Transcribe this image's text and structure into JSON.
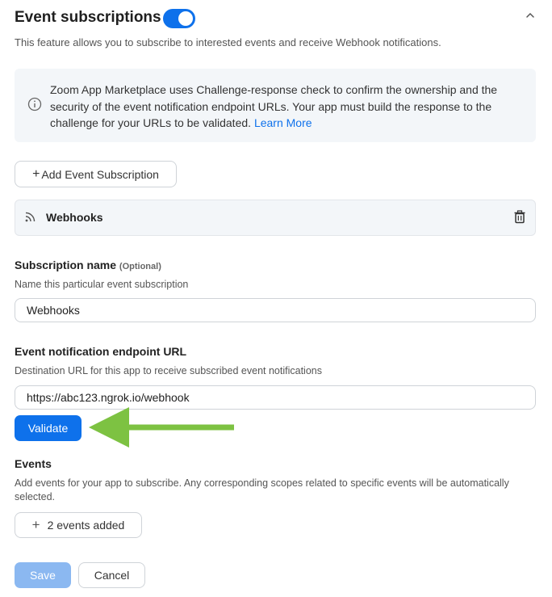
{
  "header": {
    "title": "Event subscriptions",
    "toggle_on": true,
    "description": "This feature allows you to subscribe to interested events and receive Webhook notifications."
  },
  "info": {
    "text": "Zoom App Marketplace uses Challenge-response check to confirm the ownership and the security of the event notification endpoint URLs. Your app must build the response to the challenge for your URLs to be validated.",
    "link_label": "Learn More"
  },
  "add_subscription_label": "Add Event Subscription",
  "subscription_card": {
    "name": "Webhooks"
  },
  "subscription_name": {
    "label": "Subscription name",
    "optional": "(Optional)",
    "help": "Name this particular event subscription",
    "value": "Webhooks"
  },
  "endpoint": {
    "label": "Event notification endpoint URL",
    "help": "Destination URL for this app to receive subscribed event notifications",
    "value": "https://abc123.ngrok.io/webhook",
    "validate_label": "Validate"
  },
  "events": {
    "label": "Events",
    "help": "Add events for your app to subscribe. Any corresponding scopes related to specific events will be automatically selected.",
    "added_label": "2 events added"
  },
  "footer": {
    "save_label": "Save",
    "cancel_label": "Cancel"
  },
  "colors": {
    "accent": "#0e71eb",
    "save_disabled": "#8bb8f1",
    "annotation_arrow": "#7dc242"
  }
}
